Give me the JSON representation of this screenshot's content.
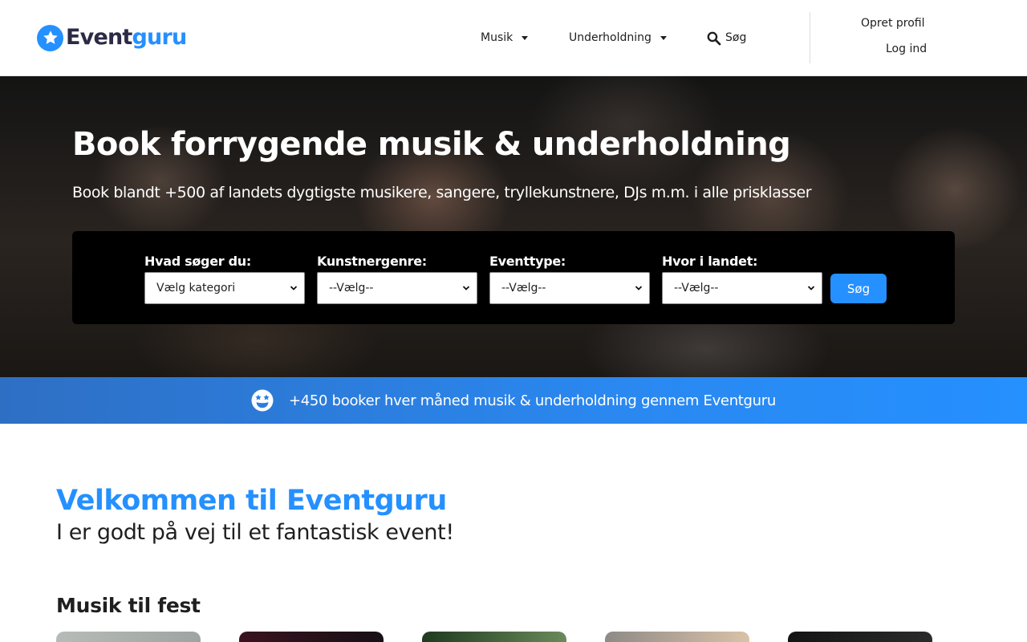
{
  "header": {
    "logo": {
      "part1": "Event",
      "part2": "guru"
    },
    "nav": {
      "musik": "Musik",
      "underholdning": "Underholdning",
      "search": "Søg"
    },
    "account": {
      "create_profile": "Opret profil",
      "login": "Log ind"
    }
  },
  "hero": {
    "title": "Book forrygende musik & underholdning",
    "subtitle": "Book blandt +500 af landets dygtigste musikere, sangere, tryllekunstnere, DJs m.m. i alle prisklasser",
    "search": {
      "fields": [
        {
          "label": "Hvad søger du:",
          "value": "Vælg kategori"
        },
        {
          "label": "Kunstnergenre:",
          "value": "--Vælg--"
        },
        {
          "label": "Eventtype:",
          "value": "--Vælg--"
        },
        {
          "label": "Hvor i landet:",
          "value": "--Vælg--"
        }
      ],
      "button": "Søg"
    }
  },
  "stats": {
    "icon": "star-struck-face-icon",
    "text": "+450 booker hver måned musik & underholdning gennem Eventguru"
  },
  "welcome": {
    "title": "Velkommen til Eventguru",
    "subtitle": "I er godt på vej til et fantastisk event!"
  },
  "section": {
    "title": "Musik til fest"
  },
  "colors": {
    "brand": "#2590ff",
    "dark_text": "#1f1f1f",
    "logo_dark": "#2b2b46"
  }
}
